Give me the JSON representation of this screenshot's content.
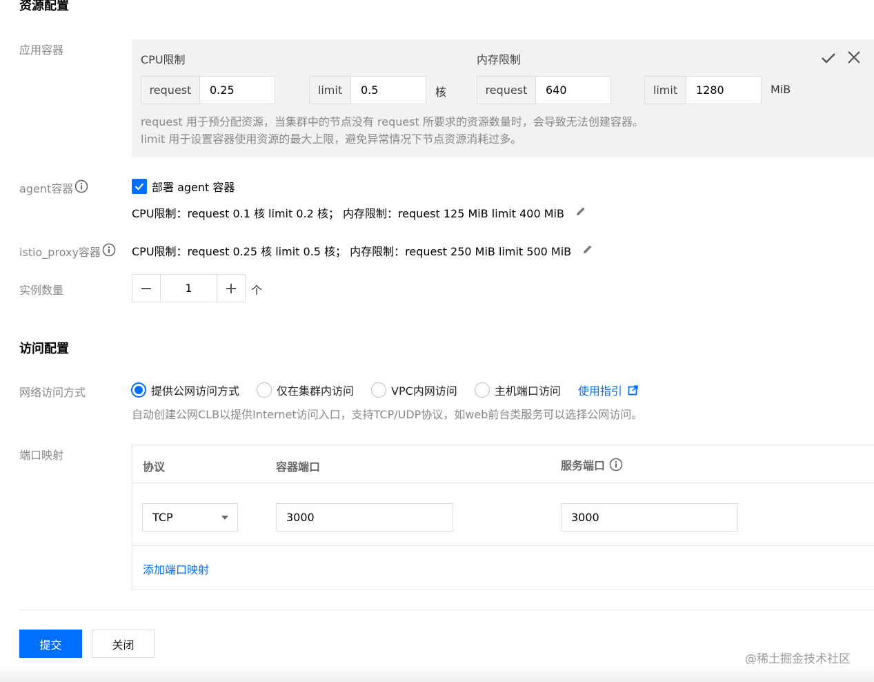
{
  "resource": {
    "title": "资源配置",
    "app_container_label": "应用容器",
    "cpu_limit_title": "CPU限制",
    "mem_limit_title": "内存限制",
    "cpu_request_label": "request",
    "cpu_request_value": "0.25",
    "cpu_limit_label": "limit",
    "cpu_limit_value": "0.5",
    "cpu_unit": "核",
    "mem_request_label": "request",
    "mem_request_value": "640",
    "mem_limit_label": "limit",
    "mem_limit_value": "1280",
    "mem_unit": "MiB",
    "note_line1": "request 用于预分配资源，当集群中的节点没有 request 所要求的资源数量时，会导致无法创建容器。",
    "note_line2": "limit 用于设置容器使用资源的最大上限，避免异常情况下节点资源消耗过多。",
    "agent_label": "agent容器",
    "agent_checkbox_label": "部署 agent 容器",
    "agent_checked": true,
    "agent_summary": "CPU限制：request 0.1 核 limit 0.2 核； 内存限制：request 125 MiB limit 400 MiB",
    "istio_label": "istio_proxy容器",
    "istio_summary": "CPU限制：request 0.25 核 limit 0.5 核； 内存限制：request 250 MiB limit 500 MiB",
    "instances_label": "实例数量",
    "instances_value": "1",
    "instances_unit": "个"
  },
  "access": {
    "title": "访问配置",
    "network_label": "网络访问方式",
    "options": [
      "提供公网访问方式",
      "仅在集群内访问",
      "VPC内网访问",
      "主机端口访问"
    ],
    "selected_index": 0,
    "guide_link": "使用指引",
    "network_note": "自动创建公网CLB以提供Internet访问入口，支持TCP/UDP协议，如web前台类服务可以选择公网访问。",
    "port_label": "端口映射",
    "table_headers": {
      "protocol": "协议",
      "container_port": "容器端口",
      "service_port": "服务端口"
    },
    "rows": [
      {
        "protocol": "TCP",
        "container_port": "3000",
        "service_port": "3000"
      }
    ],
    "add_port_link": "添加端口映射"
  },
  "footer": {
    "submit": "提交",
    "close": "关闭",
    "watermark": "@稀土掘金技术社区"
  },
  "colors": {
    "primary": "#006eff",
    "label_gray": "#888888",
    "panel_gray": "#f2f2f2"
  }
}
